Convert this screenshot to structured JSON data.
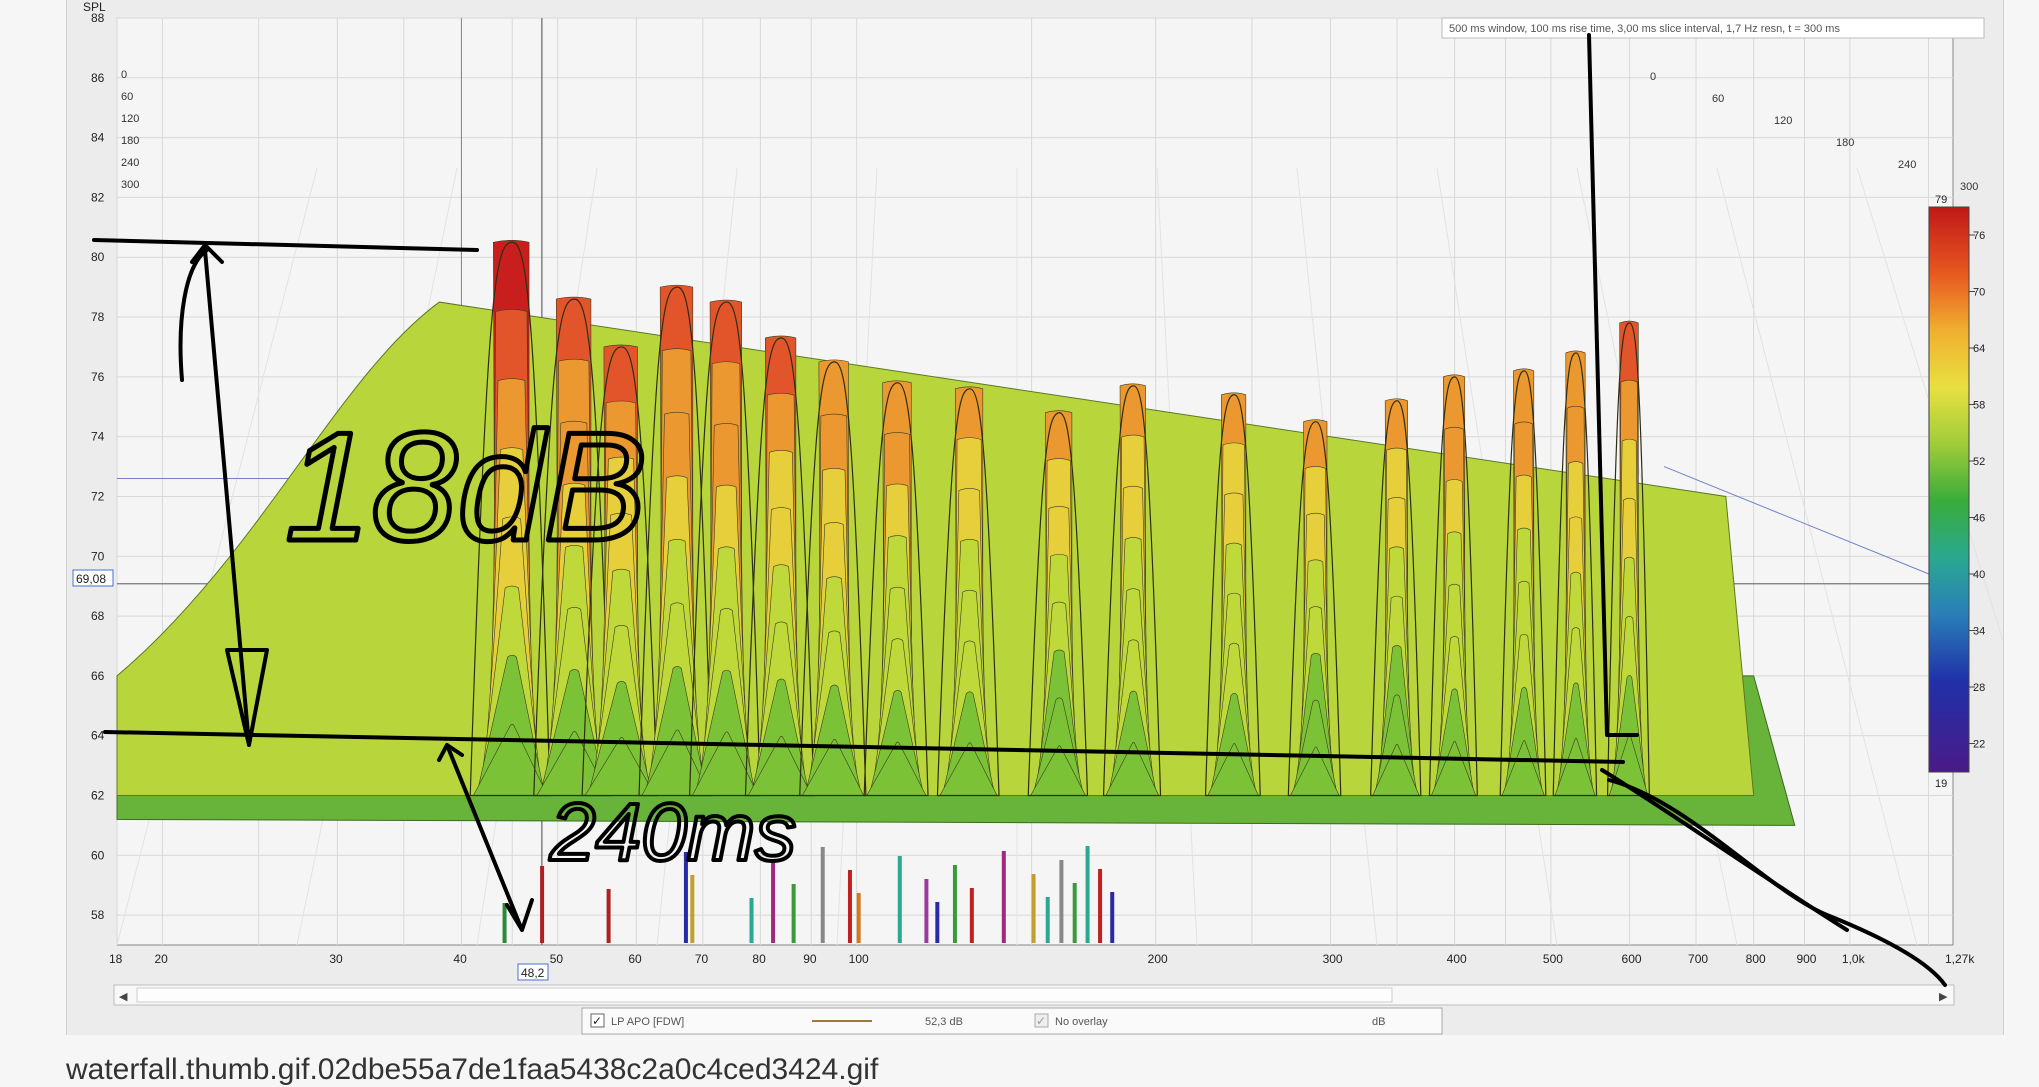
{
  "caption": "waterfall.thumb.gif.02dbe55a7de1faa5438c2a0c4ced3424.gif",
  "chart_data": {
    "type": "waterfall",
    "ylabel": "SPL",
    "info_text": "500 ms window, 100 ms rise time, 3,00 ms slice interval, 1,7 Hz resn, t = 300 ms",
    "y_ticks": [
      "88",
      "86",
      "84",
      "82",
      "80",
      "78",
      "76",
      "74",
      "72",
      "70",
      "68",
      "66",
      "64",
      "62",
      "60",
      "58"
    ],
    "y_cursor": "69,08",
    "x_ticks": [
      "18",
      "20",
      "30",
      "40",
      "50",
      "60",
      "70",
      "80",
      "90",
      "100",
      "200",
      "300",
      "400",
      "500",
      "600",
      "700",
      "800",
      "900",
      "1,0k",
      "1,27k"
    ],
    "x_cursor": "48,2",
    "ylim": [
      57,
      88
    ],
    "xlim": [
      18,
      1270
    ],
    "x_scale": "log",
    "time_ticks_left": [
      "0",
      "60",
      "120",
      "180",
      "240",
      "300"
    ],
    "time_ticks_right": [
      "0",
      "60",
      "120",
      "180",
      "240",
      "300"
    ],
    "colorbar": {
      "max_label": "79",
      "min_label": "19",
      "ticks": [
        "76",
        "70",
        "64",
        "58",
        "52",
        "46",
        "40",
        "34",
        "28",
        "22"
      ]
    },
    "peaks": [
      {
        "f": 45,
        "spl": 80.5
      },
      {
        "f": 52,
        "spl": 78.6
      },
      {
        "f": 58,
        "spl": 77
      },
      {
        "f": 66,
        "spl": 79
      },
      {
        "f": 74,
        "spl": 78.5
      },
      {
        "f": 84,
        "spl": 77.3
      },
      {
        "f": 95,
        "spl": 76.5
      },
      {
        "f": 110,
        "spl": 75.8
      },
      {
        "f": 130,
        "spl": 75.6
      },
      {
        "f": 160,
        "spl": 74.8
      },
      {
        "f": 190,
        "spl": 75.7
      },
      {
        "f": 240,
        "spl": 75.4
      },
      {
        "f": 290,
        "spl": 74.5
      },
      {
        "f": 350,
        "spl": 75.2
      },
      {
        "f": 400,
        "spl": 76
      },
      {
        "f": 470,
        "spl": 76.2
      },
      {
        "f": 530,
        "spl": 76.8
      },
      {
        "f": 600,
        "spl": 77.8
      }
    ],
    "legend": {
      "series_name": "LP APO [FDW]",
      "value": "52,3 dB",
      "overlay": "No overlay",
      "unit": "dB"
    },
    "annotations": {
      "level": "18dB",
      "time": "240ms"
    },
    "colors": {
      "hot": "#c81e1e",
      "mid": "#e8d23c",
      "cool": "#6ab42d",
      "annotation": "#000000"
    }
  }
}
